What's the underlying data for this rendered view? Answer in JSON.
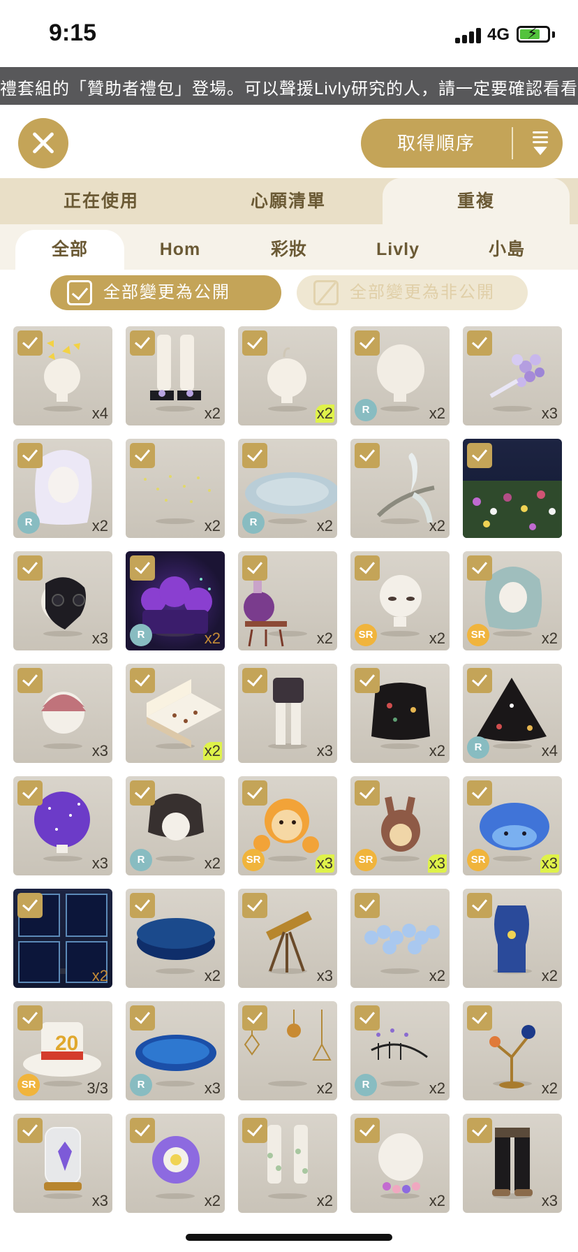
{
  "status": {
    "time": "9:15",
    "network": "4G"
  },
  "marquee": {
    "text": "禮套組的「贊助者禮包」登場。可以聲援Livly研究的人，請一定要確認看看喔！"
  },
  "header": {
    "sort_label": "取得順序"
  },
  "main_tabs": [
    {
      "label": "正在使用"
    },
    {
      "label": "心願清單"
    },
    {
      "label": "重複"
    }
  ],
  "sub_tabs": [
    {
      "label": "全部"
    },
    {
      "label": "Hom"
    },
    {
      "label": "彩妝"
    },
    {
      "label": "Livly"
    },
    {
      "label": "小島"
    }
  ],
  "actions": {
    "make_public": "全部變更為公開",
    "make_private": "全部變更為非公開"
  },
  "items": [
    {
      "name": "butterfly-hair-accessory",
      "rarity": "",
      "count": "x4",
      "highlight": false
    },
    {
      "name": "white-tights-black-shoes",
      "rarity": "",
      "count": "x2",
      "highlight": false
    },
    {
      "name": "pale-head-item",
      "rarity": "",
      "count": "x2",
      "highlight": true
    },
    {
      "name": "white-hair",
      "rarity": "R",
      "count": "x2",
      "highlight": false
    },
    {
      "name": "lavender-bouquet",
      "rarity": "",
      "count": "x3",
      "highlight": false
    },
    {
      "name": "long-white-hair",
      "rarity": "R",
      "count": "x2",
      "highlight": false
    },
    {
      "name": "fireflies",
      "rarity": "",
      "count": "x2",
      "highlight": false
    },
    {
      "name": "glass-plate",
      "rarity": "R",
      "count": "x2",
      "highlight": false
    },
    {
      "name": "white-peacock-branch",
      "rarity": "",
      "count": "x2",
      "highlight": false
    },
    {
      "name": "flower-field",
      "rarity": "",
      "count": "",
      "highlight": false
    },
    {
      "name": "plague-doctor-mask",
      "rarity": "",
      "count": "x3",
      "highlight": false
    },
    {
      "name": "purple-night-forest",
      "rarity": "R",
      "count": "x2",
      "highlight": false
    },
    {
      "name": "potion-table",
      "rarity": "",
      "count": "x2",
      "highlight": false
    },
    {
      "name": "sleepy-eyes-face",
      "rarity": "SR",
      "count": "x2",
      "highlight": false
    },
    {
      "name": "teal-long-hair",
      "rarity": "SR",
      "count": "x2",
      "highlight": false
    },
    {
      "name": "pink-short-hair",
      "rarity": "",
      "count": "x3",
      "highlight": false
    },
    {
      "name": "chocolate-box",
      "rarity": "",
      "count": "x2",
      "highlight": true
    },
    {
      "name": "dark-shorts-tights",
      "rarity": "",
      "count": "x3",
      "highlight": false
    },
    {
      "name": "embroidered-black-blouse",
      "rarity": "",
      "count": "x2",
      "highlight": false
    },
    {
      "name": "embroidered-black-cape",
      "rarity": "R",
      "count": "x4",
      "highlight": false
    },
    {
      "name": "galaxy-afro-hair",
      "rarity": "",
      "count": "x3",
      "highlight": false
    },
    {
      "name": "black-bob-hair",
      "rarity": "R",
      "count": "x2",
      "highlight": false
    },
    {
      "name": "orange-plush-monkey",
      "rarity": "SR",
      "count": "x3",
      "highlight": true
    },
    {
      "name": "bunny-hood-monkey",
      "rarity": "SR",
      "count": "x3",
      "highlight": true
    },
    {
      "name": "blue-hedgehog-plush",
      "rarity": "SR",
      "count": "x3",
      "highlight": true
    },
    {
      "name": "starry-window",
      "rarity": "",
      "count": "x2",
      "highlight": false
    },
    {
      "name": "navy-round-stage",
      "rarity": "",
      "count": "x2",
      "highlight": false
    },
    {
      "name": "brass-telescope",
      "rarity": "",
      "count": "x3",
      "highlight": false
    },
    {
      "name": "blue-hydrangea-garland",
      "rarity": "",
      "count": "x2",
      "highlight": false
    },
    {
      "name": "blue-palm-lamp",
      "rarity": "",
      "count": "x2",
      "highlight": false
    },
    {
      "name": "anniversary-top-hat",
      "rarity": "SR",
      "count": "3/3",
      "highlight": false
    },
    {
      "name": "blue-mosaic-rug",
      "rarity": "R",
      "count": "x3",
      "highlight": false
    },
    {
      "name": "hanging-geometric-ornaments",
      "rarity": "",
      "count": "x2",
      "highlight": false
    },
    {
      "name": "music-note-garland",
      "rarity": "R",
      "count": "x2",
      "highlight": false
    },
    {
      "name": "planet-stand",
      "rarity": "",
      "count": "x2",
      "highlight": false
    },
    {
      "name": "crystal-jar",
      "rarity": "",
      "count": "x3",
      "highlight": false
    },
    {
      "name": "purple-flower-hat",
      "rarity": "",
      "count": "x2",
      "highlight": false
    },
    {
      "name": "vine-leg-warmers",
      "rarity": "",
      "count": "x2",
      "highlight": false
    },
    {
      "name": "flower-collar",
      "rarity": "",
      "count": "x2",
      "highlight": false
    },
    {
      "name": "black-pants-boots",
      "rarity": "",
      "count": "x3",
      "highlight": false
    }
  ],
  "colors": {
    "accent": "#c4a458",
    "tab_bg": "#e9dfc7",
    "rarity_r": "#88bcc1",
    "rarity_sr": "#f0b43c"
  }
}
